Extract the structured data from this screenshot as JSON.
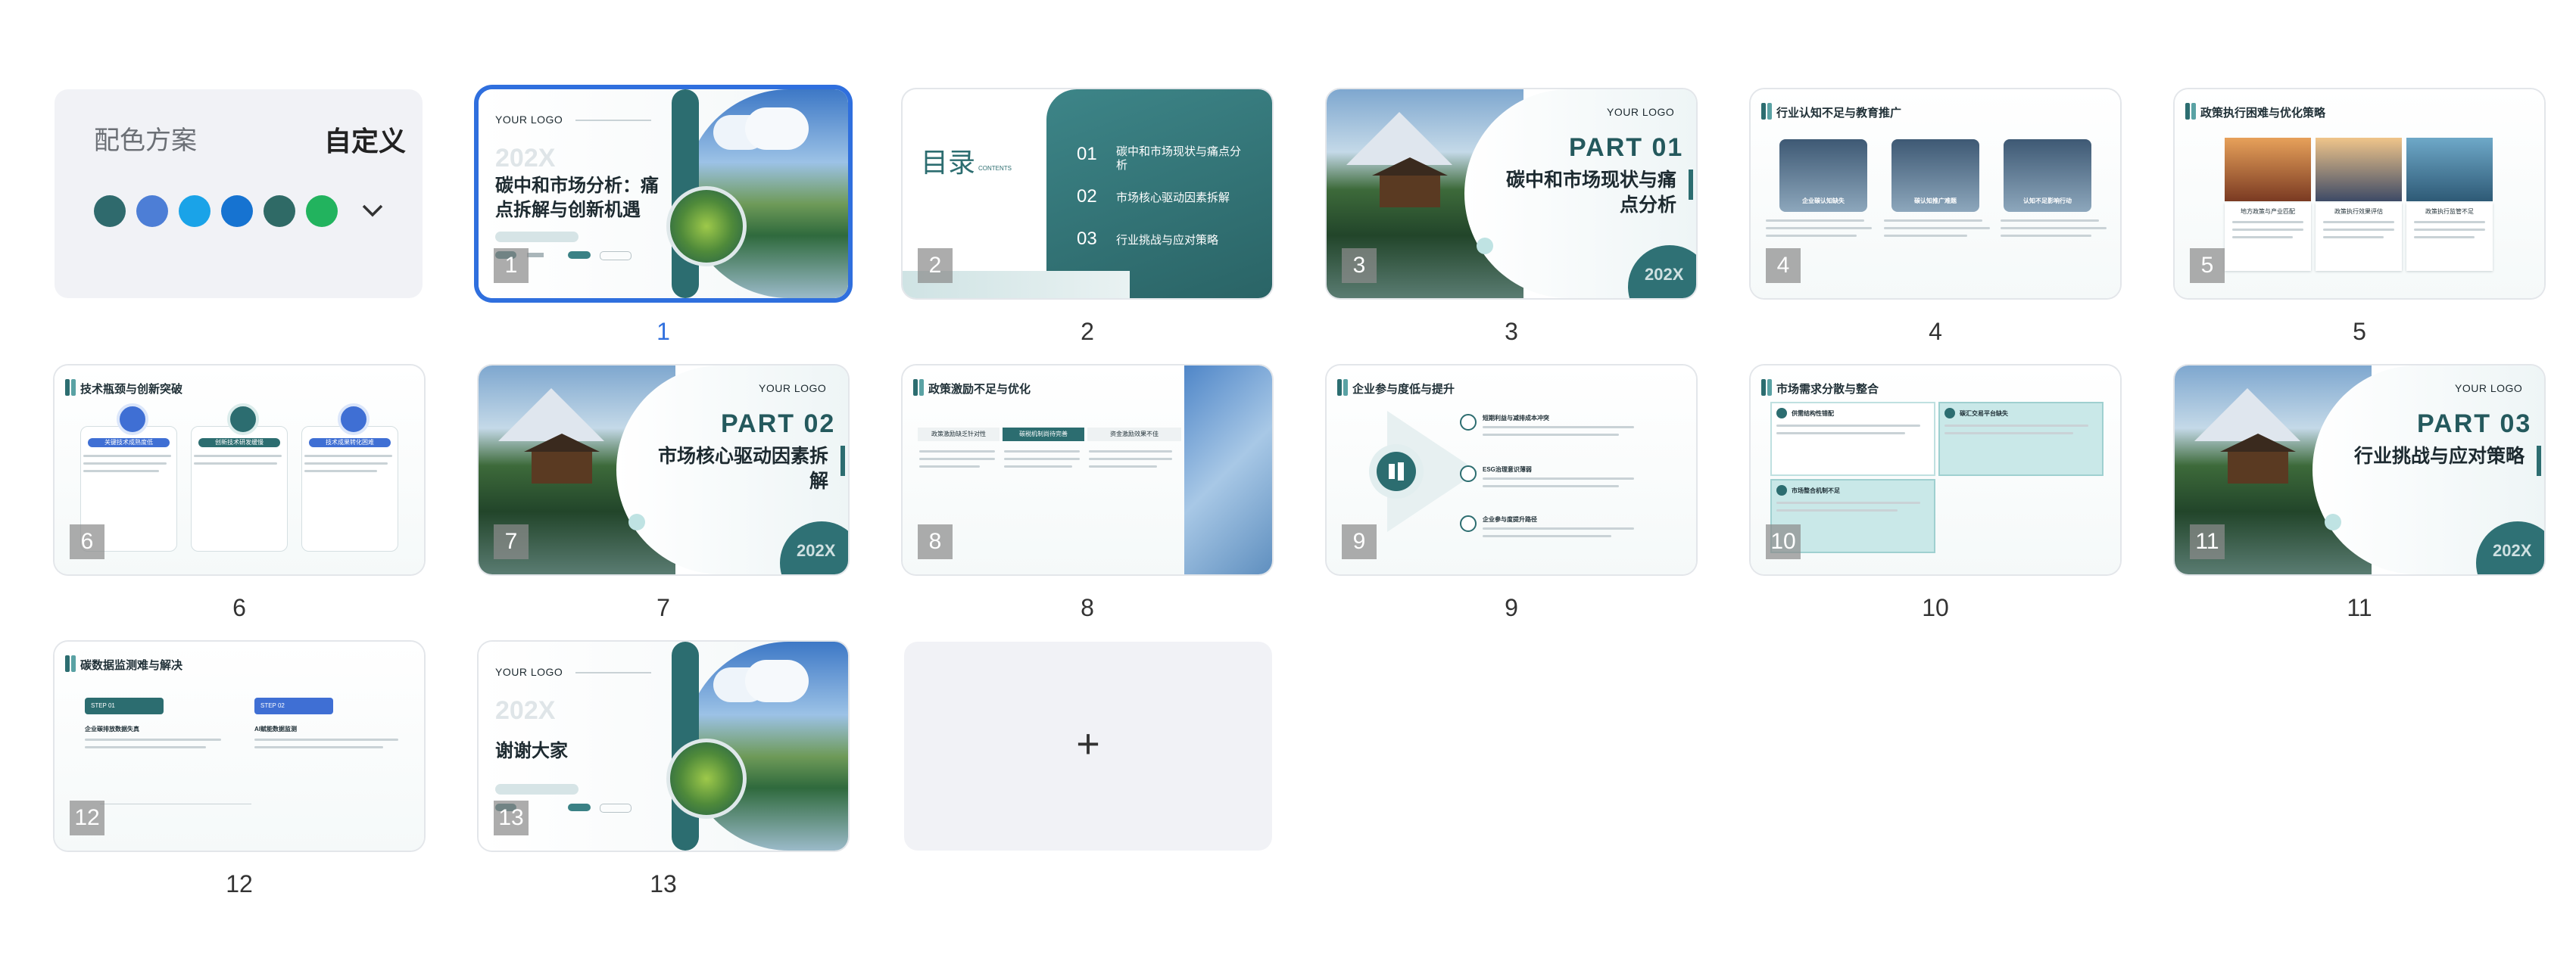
{
  "scheme_panel": {
    "label": "配色方案",
    "value": "自定义",
    "swatches": [
      "#2f6a6d",
      "#4d7ed6",
      "#1aa3e8",
      "#1673d1",
      "#2f6a66",
      "#22b35e"
    ]
  },
  "add_button": {
    "label": "+"
  },
  "slides": [
    {
      "number": "1",
      "badge": "1",
      "logo": "YOUR LOGO",
      "year": "202X",
      "title_line1": "碳中和市场分析：痛",
      "title_line2": "点拆解与创新机遇"
    },
    {
      "number": "2",
      "badge": "2",
      "heading": "目录",
      "heading_en": "CONTENTS",
      "items": [
        {
          "num": "01",
          "text1": "碳中和市场现状与痛点分",
          "text2": "析"
        },
        {
          "num": "02",
          "text1": "市场核心驱动因素拆解",
          "text2": ""
        },
        {
          "num": "03",
          "text1": "行业挑战与应对策略",
          "text2": ""
        }
      ]
    },
    {
      "number": "3",
      "badge": "3",
      "logo": "YOUR LOGO",
      "part": "PART 01",
      "title_line1": "碳中和市场现状与痛",
      "title_line2": "点分析",
      "year": "202X"
    },
    {
      "number": "4",
      "badge": "4",
      "title": "行业认知不足与教育推广",
      "cards": [
        "企业碳认知缺失",
        "碳认知推广难题",
        "认知不足影响行动"
      ]
    },
    {
      "number": "5",
      "badge": "5",
      "title": "政策执行困难与优化策略",
      "cards": [
        "地方政策与产业匹配",
        "政策执行效果评估",
        "政策执行监管不足"
      ]
    },
    {
      "number": "6",
      "badge": "6",
      "title": "技术瓶颈与创新突破",
      "cards": [
        "关键技术成熟度低",
        "创新技术研发缓慢",
        "技术成果转化困难"
      ]
    },
    {
      "number": "7",
      "badge": "7",
      "logo": "YOUR LOGO",
      "part": "PART 02",
      "title_line1": "市场核心驱动因素拆",
      "title_line2": "解",
      "year": "202X"
    },
    {
      "number": "8",
      "badge": "8",
      "title": "政策激励不足与优化",
      "tabs": [
        "政策激励缺乏针对性",
        "碳税机制尚待完善",
        "资金激励效果不佳"
      ]
    },
    {
      "number": "9",
      "badge": "9",
      "title": "企业参与度低与提升",
      "items": [
        "短期利益与减排成本冲突",
        "ESG治理意识薄弱",
        "企业参与度提升路径"
      ]
    },
    {
      "number": "10",
      "badge": "10",
      "title": "市场需求分散与整合",
      "items": [
        "供需结构性错配",
        "碳汇交易平台缺失",
        "市场整合机制不足"
      ]
    },
    {
      "number": "11",
      "badge": "11",
      "logo": "YOUR LOGO",
      "part": "PART 03",
      "title_line1": "行业挑战与应对策略",
      "title_line2": "",
      "year": "202X"
    },
    {
      "number": "12",
      "badge": "12",
      "title": "碳数据监测难与解决",
      "steps": [
        {
          "tag": "STEP 01",
          "head": "企业碳排放数据失真"
        },
        {
          "tag": "STEP 02",
          "head": "AI赋能数据监测"
        }
      ]
    },
    {
      "number": "13",
      "badge": "13",
      "logo": "YOUR LOGO",
      "year": "202X",
      "title_line1": "谢谢大家"
    }
  ]
}
